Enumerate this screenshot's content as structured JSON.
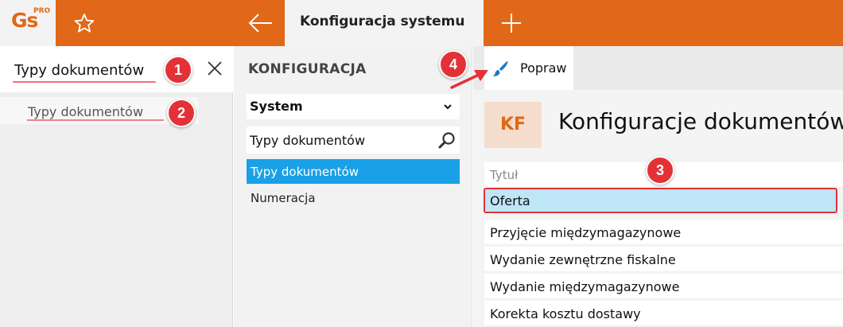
{
  "app": {
    "logo_text": "Gs",
    "logo_sup": "PRO",
    "active_tab": "Konfiguracja systemu"
  },
  "search_panel": {
    "query": "Typy dokumentów",
    "result": "Typy dokumentów"
  },
  "callouts": [
    "1",
    "2",
    "3",
    "4"
  ],
  "config_nav": {
    "heading": "KONFIGURACJA",
    "section_select": "System",
    "filter_value": "Typy dokumentów",
    "items": [
      {
        "label": "Typy dokumentów",
        "active": true
      },
      {
        "label": "Numeracja",
        "active": false
      }
    ]
  },
  "content": {
    "toolbar": {
      "edit_label": "Popraw"
    },
    "badge": "KF",
    "title": "Konfiguracje dokumentów",
    "column_header": "Tytuł",
    "rows": [
      "Oferta",
      "Przyjęcie międzymagazynowe",
      "Wydanie zewnętrzne fiskalne",
      "Wydanie międzymagazynowe",
      "Korekta kosztu dostawy"
    ],
    "selected_row_index": 0
  },
  "colors": {
    "accent": "#e06818",
    "selection": "#1aa0e6",
    "row_highlight": "#bfe6f7",
    "callout": "#e23238"
  },
  "icons": [
    "star-icon",
    "back-arrow-icon",
    "plus-icon",
    "close-icon",
    "chevron-down-icon",
    "search-icon",
    "brush-icon",
    "callout-arrow"
  ]
}
